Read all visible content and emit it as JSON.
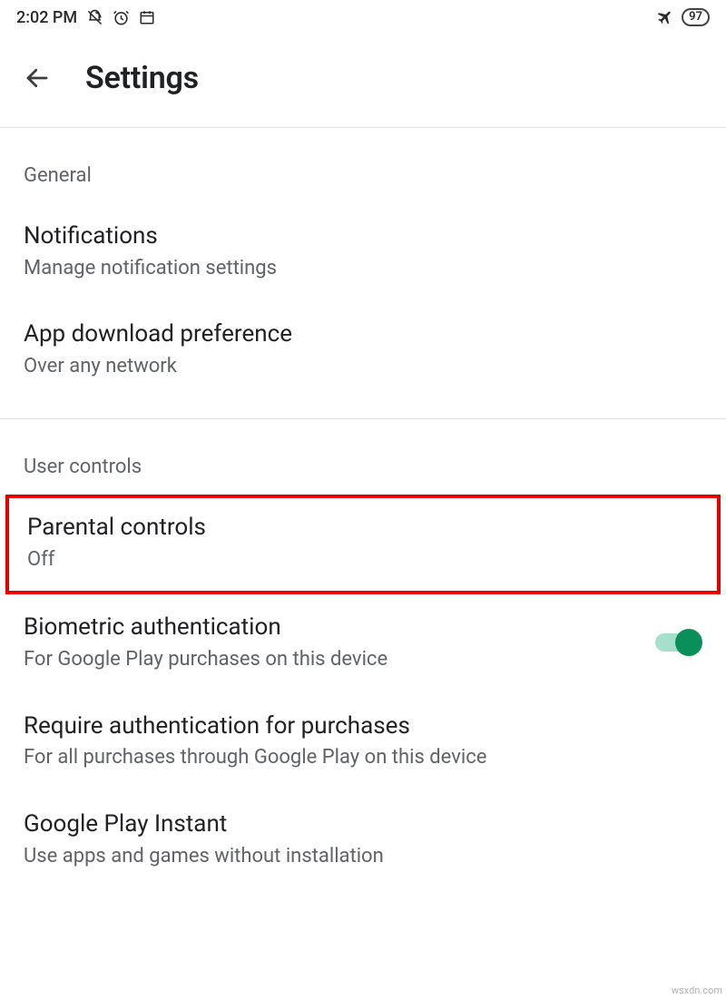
{
  "status": {
    "time": "2:02 PM",
    "battery": "97"
  },
  "appbar": {
    "title": "Settings"
  },
  "sections": {
    "general": {
      "header": "General",
      "notifications": {
        "title": "Notifications",
        "sub": "Manage notification settings"
      },
      "download": {
        "title": "App download preference",
        "sub": "Over any network"
      }
    },
    "user": {
      "header": "User controls",
      "parental": {
        "title": "Parental controls",
        "sub": "Off"
      },
      "biometric": {
        "title": "Biometric authentication",
        "sub": "For Google Play purchases on this device"
      },
      "requireauth": {
        "title": "Require authentication for purchases",
        "sub": "For all purchases through Google Play on this device"
      },
      "instant": {
        "title": "Google Play Instant",
        "sub": "Use apps and games without installation"
      }
    }
  },
  "watermark": "wsxdn.com"
}
